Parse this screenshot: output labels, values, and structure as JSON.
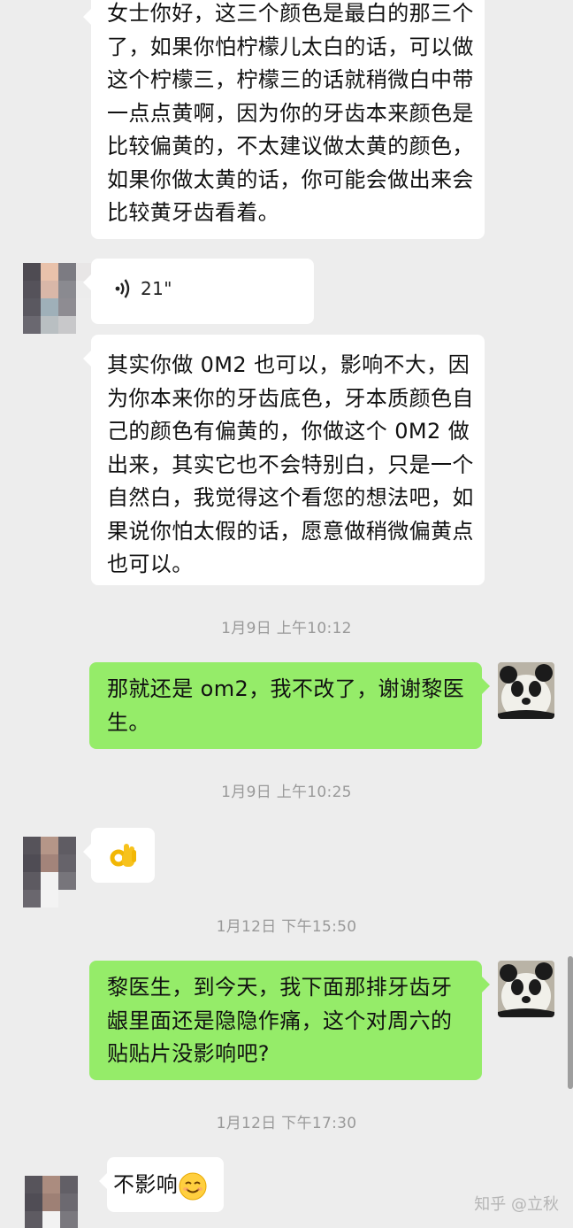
{
  "messages": [
    {
      "side": "in",
      "type": "text",
      "text": "女士你好，这三个颜色是最白的那三个了，如果你怕柠檬儿太白的话，可以做这个柠檬三，柠檬三的话就稍微白中带一点点黄啊，因为你的牙齿本来颜色是比较偏黄的，不太建议做太黄的颜色，如果你做太黄的话，你可能会做出来会比较黄牙齿看着。"
    },
    {
      "side": "in",
      "type": "voice",
      "duration": "21\""
    },
    {
      "side": "in",
      "type": "text",
      "text": "其实你做 0M2 也可以，影响不大，因为你本来你的牙齿底色，牙本质颜色自己的颜色有偏黄的，你做这个 0M2 做出来，其实它也不会特别白，只是一个自然白，我觉得这个看您的想法吧，如果说你怕太假的话，愿意做稍微偏黄点也可以。"
    },
    {
      "type": "time",
      "text": "1月9日 上午10:12"
    },
    {
      "side": "out",
      "type": "text",
      "text": "那就还是 om2，我不改了，谢谢黎医生。"
    },
    {
      "type": "time",
      "text": "1月9日 上午10:25"
    },
    {
      "side": "in",
      "type": "emoji",
      "emoji": "ok-hand"
    },
    {
      "type": "time",
      "text": "1月12日 下午15:50"
    },
    {
      "side": "out",
      "type": "text",
      "text": "黎医生，到今天，我下面那排牙齿牙龈里面还是隐隐作痛，这个对周六的贴贴片没影响吧?"
    },
    {
      "type": "time",
      "text": "1月12日 下午17:30"
    },
    {
      "side": "in",
      "type": "text+emoji",
      "text": "不影响",
      "emoji": "smile"
    }
  ],
  "watermark": "知乎 @立秋",
  "colors": {
    "background": "#ededed",
    "incoming": "#ffffff",
    "outgoing": "#95ec69",
    "time": "#999999"
  }
}
